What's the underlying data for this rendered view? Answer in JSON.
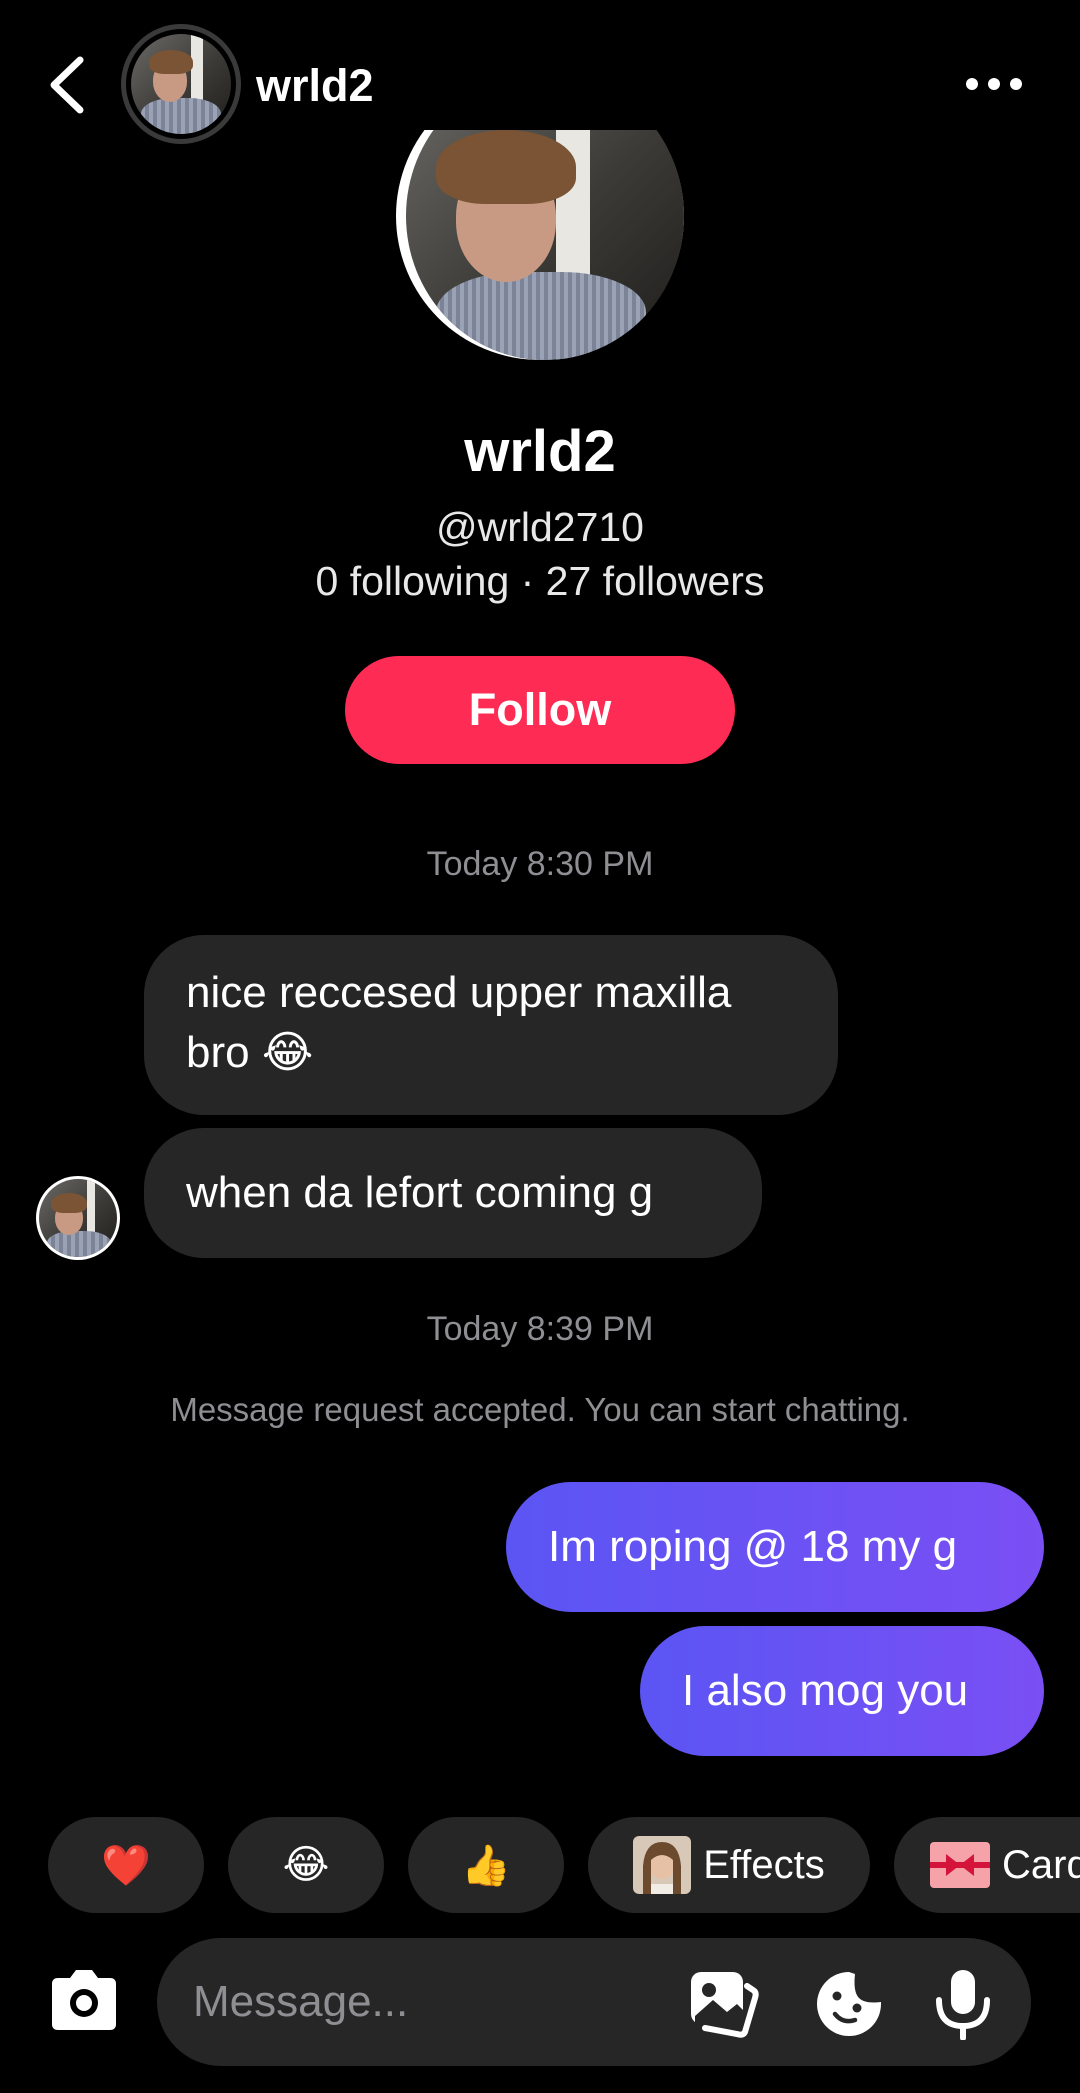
{
  "header": {
    "name": "wrld2"
  },
  "profile": {
    "name": "wrld2",
    "handle": "@wrld2710",
    "stats": "0 following · 27 followers",
    "follow_label": "Follow"
  },
  "messages": {
    "timestamp_1": "Today 8:30 PM",
    "incoming_1": "nice reccesed upper maxilla bro 😂",
    "incoming_2": "when da lefort coming g",
    "timestamp_2": "Today 8:39 PM",
    "system": "Message request accepted. You can start chatting.",
    "outgoing_1": "Im roping @ 18 my g",
    "outgoing_2": "I also mog you"
  },
  "quick_replies": [
    {
      "icon": "❤️"
    },
    {
      "icon": "😂"
    },
    {
      "icon": "👍"
    },
    {
      "label": "Effects"
    },
    {
      "label": "Card"
    }
  ],
  "composer": {
    "placeholder": "Message..."
  },
  "colors": {
    "follow": "#fe2c55",
    "outgoing_start": "#5b55f4",
    "outgoing_end": "#7a4ff4",
    "incoming": "#262626"
  }
}
